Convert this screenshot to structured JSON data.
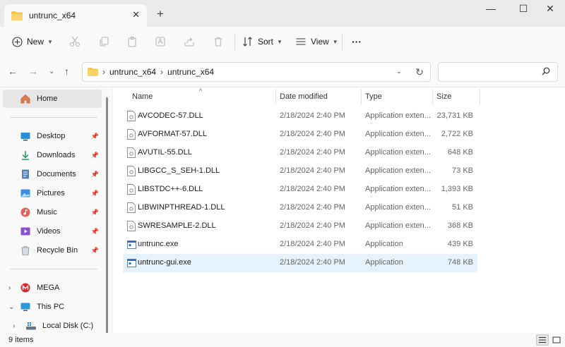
{
  "window": {
    "tab_title": "untrunc_x64",
    "tab_close": "✕",
    "new_tab": "+",
    "minimize": "—",
    "maximize": "☐",
    "close": "✕"
  },
  "toolbar": {
    "new_label": "New",
    "sort_label": "Sort",
    "view_label": "View",
    "more_label": "···"
  },
  "address": {
    "crumbs": [
      "untrunc_x64",
      "untrunc_x64"
    ],
    "separator": "›"
  },
  "search": {
    "placeholder": ""
  },
  "sidebar": {
    "home": "Home",
    "quick": [
      {
        "label": "Desktop",
        "icon": "desktop-icon"
      },
      {
        "label": "Downloads",
        "icon": "downloads-icon"
      },
      {
        "label": "Documents",
        "icon": "documents-icon"
      },
      {
        "label": "Pictures",
        "icon": "pictures-icon"
      },
      {
        "label": "Music",
        "icon": "music-icon"
      },
      {
        "label": "Videos",
        "icon": "videos-icon"
      },
      {
        "label": "Recycle Bin",
        "icon": "recycle-bin-icon"
      }
    ],
    "mega": "MEGA",
    "this_pc": "This PC",
    "local_disk": "Local Disk (C:)"
  },
  "columns": {
    "name": "Name",
    "date": "Date modified",
    "type": "Type",
    "size": "Size"
  },
  "files": [
    {
      "name": "AVCODEC-57.DLL",
      "date": "2/18/2024 2:40 PM",
      "type": "Application exten...",
      "size": "23,731 KB",
      "kind": "dll"
    },
    {
      "name": "AVFORMAT-57.DLL",
      "date": "2/18/2024 2:40 PM",
      "type": "Application exten...",
      "size": "2,722 KB",
      "kind": "dll"
    },
    {
      "name": "AVUTIL-55.DLL",
      "date": "2/18/2024 2:40 PM",
      "type": "Application exten...",
      "size": "648 KB",
      "kind": "dll"
    },
    {
      "name": "LIBGCC_S_SEH-1.DLL",
      "date": "2/18/2024 2:40 PM",
      "type": "Application exten...",
      "size": "73 KB",
      "kind": "dll"
    },
    {
      "name": "LIBSTDC++-6.DLL",
      "date": "2/18/2024 2:40 PM",
      "type": "Application exten...",
      "size": "1,393 KB",
      "kind": "dll"
    },
    {
      "name": "LIBWINPTHREAD-1.DLL",
      "date": "2/18/2024 2:40 PM",
      "type": "Application exten...",
      "size": "51 KB",
      "kind": "dll"
    },
    {
      "name": "SWRESAMPLE-2.DLL",
      "date": "2/18/2024 2:40 PM",
      "type": "Application exten...",
      "size": "368 KB",
      "kind": "dll"
    },
    {
      "name": "untrunc.exe",
      "date": "2/18/2024 2:40 PM",
      "type": "Application",
      "size": "439 KB",
      "kind": "exe"
    },
    {
      "name": "untrunc-gui.exe",
      "date": "2/18/2024 2:40 PM",
      "type": "Application",
      "size": "748 KB",
      "kind": "exe"
    }
  ],
  "selected_file": "untrunc-gui.exe",
  "status": {
    "count": "9 items"
  },
  "colors": {
    "folder": "#f4c542",
    "selection": "#e5f1fb",
    "accent": "#0067c0"
  }
}
